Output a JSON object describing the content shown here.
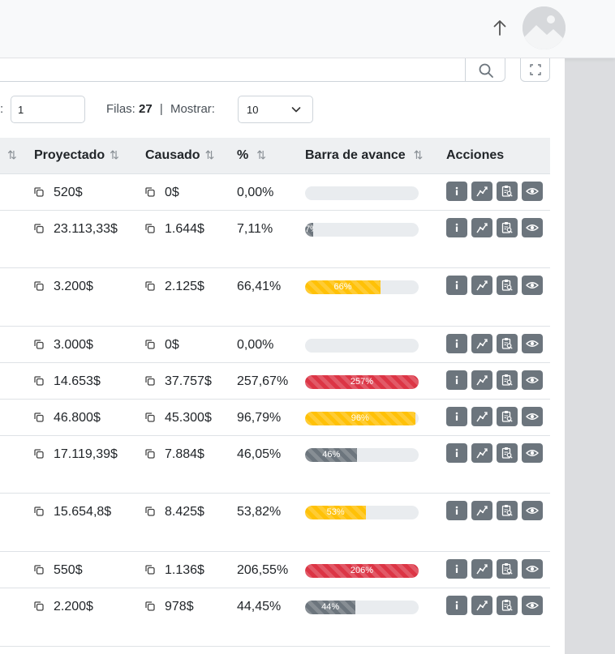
{
  "pager": {
    "colon": ":",
    "page_value": "1",
    "filas_label": "Filas:",
    "filas_count": "27",
    "separator": "|",
    "mostrar_label": "Mostrar:",
    "mostrar_value": "10"
  },
  "table": {
    "headers": {
      "proyectado": "Proyectado",
      "causado": "Causado",
      "percent": "%",
      "barra": "Barra de avance",
      "acciones": "Acciones"
    },
    "rows": [
      {
        "proyectado": "520$",
        "causado": "0$",
        "percent": "0,00%",
        "bar_label": "",
        "fill": 0,
        "color": "yellow"
      },
      {
        "proyectado": "23.113,33$",
        "causado": "1.644$",
        "percent": "7,11%",
        "bar_label": "7%",
        "fill": 0.0711,
        "color": "gray"
      },
      {
        "proyectado": "3.200$",
        "causado": "2.125$",
        "percent": "66,41%",
        "bar_label": "66%",
        "fill": 0.6641,
        "color": "yellow"
      },
      {
        "proyectado": "3.000$",
        "causado": "0$",
        "percent": "0,00%",
        "bar_label": "",
        "fill": 0,
        "color": "yellow"
      },
      {
        "proyectado": "14.653$",
        "causado": "37.757$",
        "percent": "257,67%",
        "bar_label": "257%",
        "fill": 1,
        "color": "red"
      },
      {
        "proyectado": "46.800$",
        "causado": "45.300$",
        "percent": "96,79%",
        "bar_label": "96%",
        "fill": 0.9679,
        "color": "yellow"
      },
      {
        "proyectado": "17.119,39$",
        "causado": "7.884$",
        "percent": "46,05%",
        "bar_label": "46%",
        "fill": 0.4605,
        "color": "gray"
      },
      {
        "proyectado": "15.654,8$",
        "causado": "8.425$",
        "percent": "53,82%",
        "bar_label": "53%",
        "fill": 0.5382,
        "color": "yellow"
      },
      {
        "proyectado": "550$",
        "causado": "1.136$",
        "percent": "206,55%",
        "bar_label": "206%",
        "fill": 1,
        "color": "red"
      },
      {
        "proyectado": "2.200$",
        "causado": "978$",
        "percent": "44,45%",
        "bar_label": "44%",
        "fill": 0.4445,
        "color": "gray"
      }
    ]
  },
  "icons": {
    "row_actions": [
      "info-icon",
      "chart-line-icon",
      "clipboard-search-icon",
      "eye-icon"
    ],
    "copy": "copy-icon",
    "sort": "sort-icon",
    "search": "search-icon",
    "fullscreen": "fullscreen-icon",
    "up_arrow": "arrow-up-icon"
  },
  "colors": {
    "yellow": "#ffc107",
    "red": "#dc3545",
    "gray": "#6c757d",
    "header_bg": "#eef0f2"
  }
}
